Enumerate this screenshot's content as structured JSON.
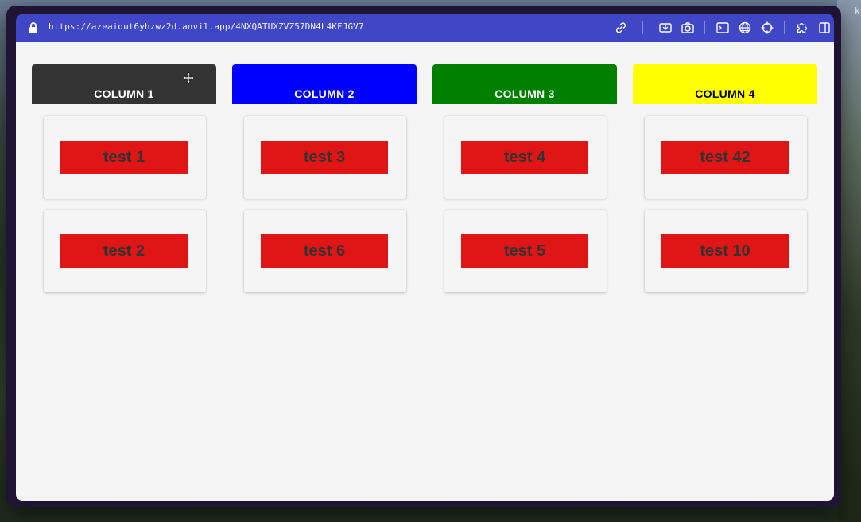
{
  "browser": {
    "url": "https://azeaidut6yhzwz2d.anvil.app/4NXQATUXZVZ57DN4L4KFJGV7",
    "toolbar_icons": [
      "link-icon",
      "save-icon",
      "camera-icon",
      "terminal-icon",
      "globe-icon",
      "crosshair-icon",
      "puzzle-icon",
      "split-view-icon"
    ]
  },
  "desktop": {
    "corner_text": "k"
  },
  "columns": [
    {
      "title": "COLUMN 1",
      "color": "#333333",
      "text_color": "#ffffff",
      "cards": [
        "test 1",
        "test 2"
      ]
    },
    {
      "title": "COLUMN 2",
      "color": "#0000ff",
      "text_color": "#ffffff",
      "cards": [
        "test 3",
        "test 6"
      ]
    },
    {
      "title": "COLUMN 3",
      "color": "#008000",
      "text_color": "#ffffff",
      "cards": [
        "test 4",
        "test 5"
      ]
    },
    {
      "title": "COLUMN 4",
      "color": "#ffff00",
      "text_color": "#000000",
      "cards": [
        "test 42",
        "test 10"
      ]
    }
  ],
  "card_color": "#e01515"
}
